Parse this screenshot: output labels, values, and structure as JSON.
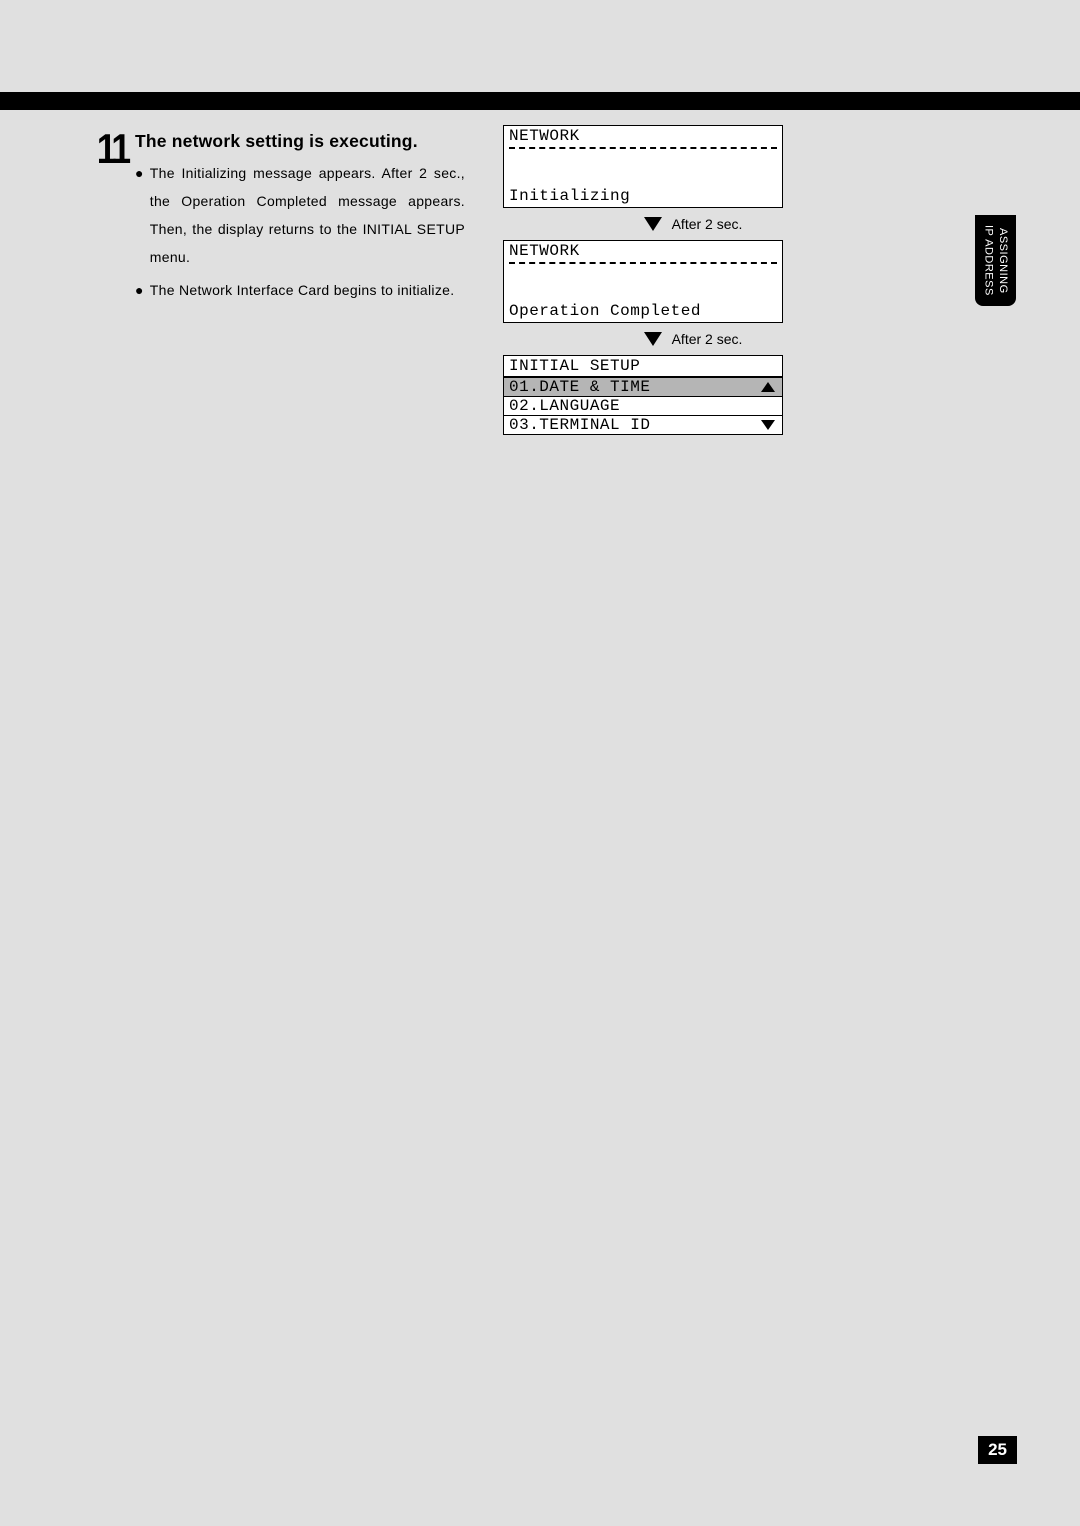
{
  "step": {
    "number": "11",
    "title": "The network setting is executing.",
    "bullets": [
      "The Initializing message appears.  After 2 sec., the Operation Completed message appears.  Then, the display returns to the INITIAL SETUP menu.",
      "The Network Interface Card begins to initialize."
    ]
  },
  "screens": {
    "screen1": {
      "header": "NETWORK",
      "text": "Initializing"
    },
    "arrow1_text": "After 2 sec.",
    "screen2": {
      "header": "NETWORK",
      "text": "Operation Completed"
    },
    "arrow2_text": "After 2 sec.",
    "menu": {
      "header": "INITIAL SETUP",
      "items": [
        {
          "label": "01.DATE & TIME",
          "highlighted": true,
          "arrow": "up"
        },
        {
          "label": "02.LANGUAGE",
          "highlighted": false,
          "arrow": "none"
        },
        {
          "label": "03.TERMINAL ID",
          "highlighted": false,
          "arrow": "down"
        }
      ]
    }
  },
  "side_tab": {
    "line1": "ASSIGNING",
    "line2": "IP ADDRESS"
  },
  "page_number": "25"
}
